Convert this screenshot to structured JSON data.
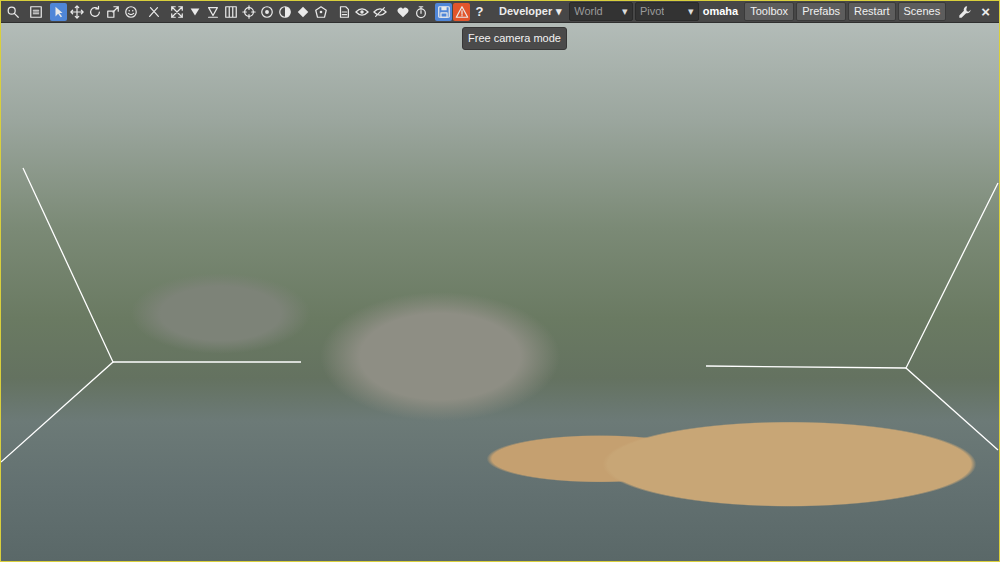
{
  "toolbar": {
    "tools": [
      {
        "active": false,
        "alert": false
      },
      {
        "active": false,
        "alert": false
      },
      {
        "active": true,
        "alert": false
      },
      {
        "active": false,
        "alert": false
      },
      {
        "active": false,
        "alert": false
      },
      {
        "active": false,
        "alert": false
      },
      {
        "active": false,
        "alert": false
      },
      {
        "active": false,
        "alert": false
      },
      {
        "active": false,
        "alert": false
      },
      {
        "active": false,
        "alert": false
      },
      {
        "active": false,
        "alert": false
      },
      {
        "active": false,
        "alert": false
      },
      {
        "active": false,
        "alert": false
      },
      {
        "active": false,
        "alert": false
      },
      {
        "active": false,
        "alert": false
      },
      {
        "active": false,
        "alert": false
      },
      {
        "active": false,
        "alert": false
      },
      {
        "active": false,
        "alert": false
      },
      {
        "active": false,
        "alert": false
      },
      {
        "active": false,
        "alert": false
      },
      {
        "active": false,
        "alert": false
      },
      {
        "active": false,
        "alert": false
      },
      {
        "active": true,
        "alert": false
      },
      {
        "active": false,
        "alert": true
      }
    ],
    "help": "?",
    "mode_menu": {
      "label": "Developer",
      "arrow": "▾"
    },
    "world_select": {
      "value": "World",
      "arrow": "▾"
    },
    "pivot_select": {
      "value": "Pivot",
      "arrow": "▾"
    },
    "project": "omaha",
    "buttons": [
      "Toolbox",
      "Prefabs",
      "Restart",
      "Scenes"
    ],
    "close": "×"
  },
  "tooltip": {
    "text": "Free camera mode"
  }
}
